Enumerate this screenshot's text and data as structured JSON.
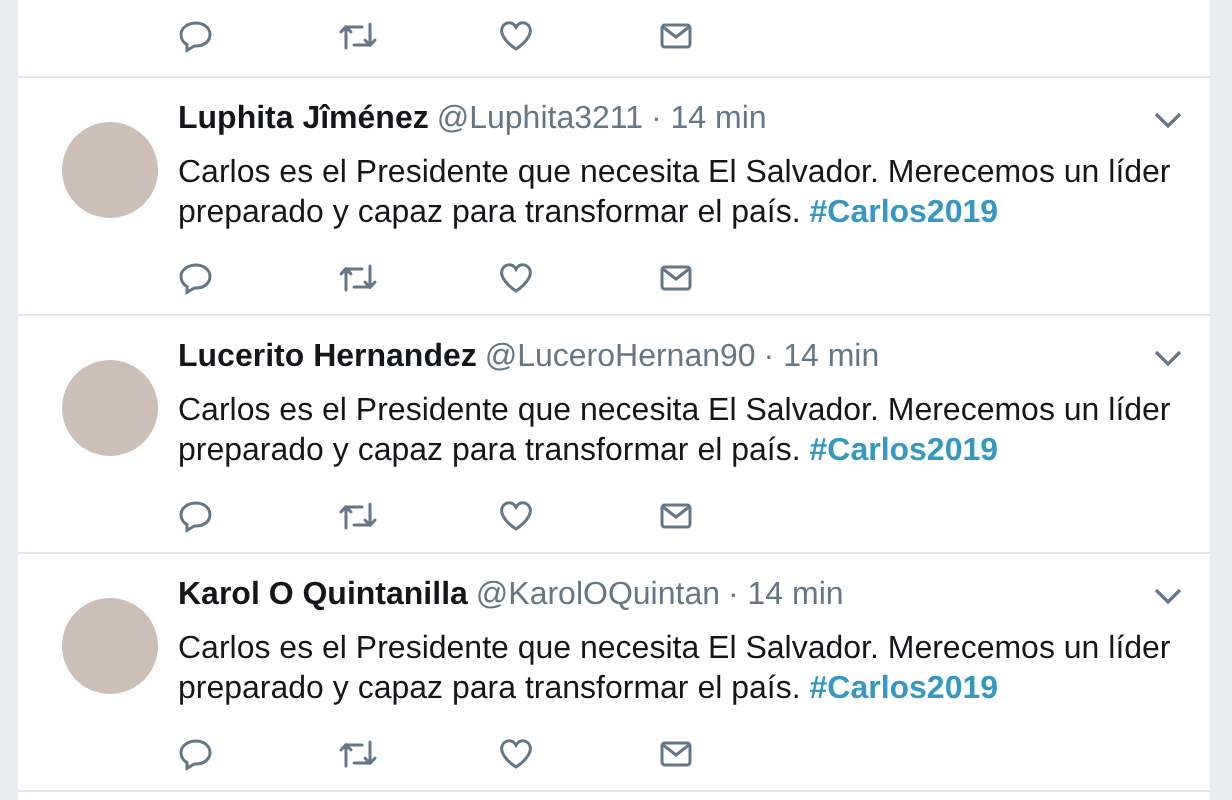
{
  "tweets": [
    {
      "kind": "cut"
    },
    {
      "kind": "full",
      "name": "Luphita Jîménez",
      "handle": "@Luphita3211",
      "time": "· 14 min",
      "text": "Carlos es el Presidente que necesita El Salvador. Merecemos un líder preparado y capaz para transformar el país.",
      "hashtag": "#Carlos2019"
    },
    {
      "kind": "full",
      "name": "Lucerito Hernandez",
      "handle": "@LuceroHernan90",
      "time": "· 14 min",
      "text": "Carlos es el Presidente que necesita El Salvador. Merecemos un líder preparado y capaz para transformar el país.",
      "hashtag": "#Carlos2019"
    },
    {
      "kind": "full",
      "name": "Karol O Quintanilla",
      "handle": "@KarolOQuintan",
      "time": "· 14 min",
      "text": "Carlos es el Presidente que necesita El Salvador. Merecemos un líder preparado y capaz para transformar el país.",
      "hashtag": "#Carlos2019"
    }
  ]
}
